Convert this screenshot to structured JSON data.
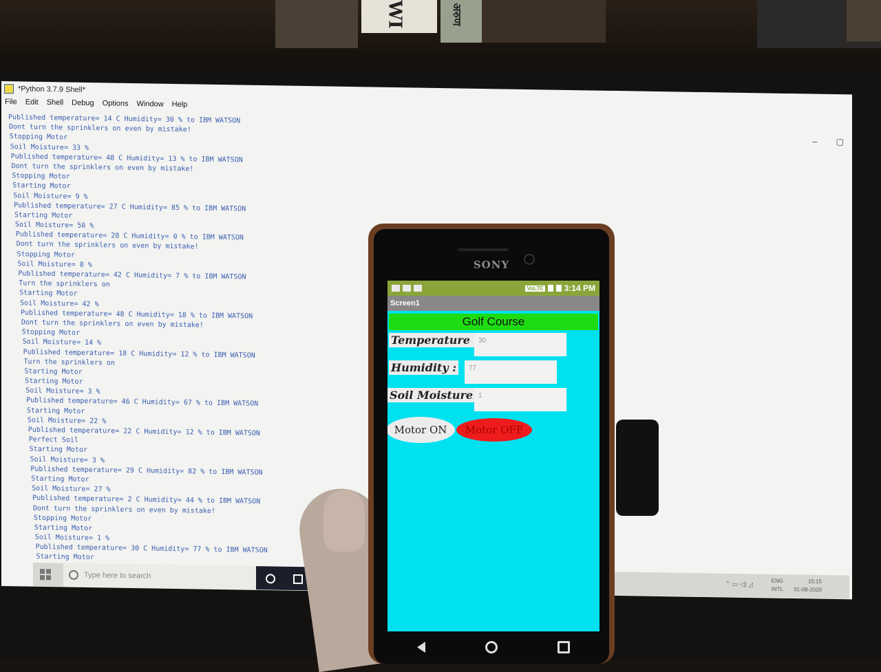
{
  "shelf": {
    "spine_text": "WI",
    "spine_text_2": "अरुण"
  },
  "window": {
    "title": "*Python 3.7.9 Shell*",
    "menu": [
      "File",
      "Edit",
      "Shell",
      "Debug",
      "Options",
      "Window",
      "Help"
    ],
    "controls": [
      "–",
      "▢"
    ]
  },
  "shell_lines": [
    "Published temperature= 14 C Humidity= 30 % to IBM WATSON",
    "Dont turn the sprinklers on even by mistake!",
    "Stopping Motor",
    "Soil Moisture= 33 %",
    "Published temperature= 48 C Humidity= 13 % to IBM WATSON",
    "Dont turn the sprinklers on even by mistake!",
    "Stopping Motor",
    "Starting Motor",
    "Soil Moisture= 9 %",
    "Published temperature= 27 C Humidity= 85 % to IBM WATSON",
    "Starting Motor",
    "Soil Moisture= 50 %",
    "Published temperature= 28 C Humidity= 0 % to IBM WATSON",
    "Dont turn the sprinklers on even by mistake!",
    "Stopping Motor",
    "Soil Moisture= 8 %",
    "Published temperature= 42 C Humidity= 7 % to IBM WATSON",
    "Turn the sprinklers on",
    "Starting Motor",
    "Soil Moisture= 42 %",
    "Published temperature= 48 C Humidity= 18 % to IBM WATSON",
    "Dont turn the sprinklers on even by mistake!",
    "Stopping Motor",
    "Soil Moisture= 14 %",
    "Published temperature= 18 C Humidity= 12 % to IBM WATSON",
    "Turn the sprinklers on",
    "Starting Motor",
    "Starting Motor",
    "Soil Moisture= 3 %",
    "Published temperature= 46 C Humidity= 67 % to IBM WATSON",
    "Starting Motor",
    "Soil Moisture= 22 %",
    "Published temperature= 22 C Humidity= 12 % to IBM WATSON",
    "Perfect Soil",
    "Starting Motor",
    "Soil Moisture= 3 %",
    "Published temperature= 29 C Humidity= 82 % to IBM WATSON",
    "Starting Motor",
    "Soil Moisture= 27 %",
    "Published temperature= 2 C Humidity= 44 % to IBM WATSON",
    "Dont turn the sprinklers on even by mistake!",
    "Stopping Motor",
    "Starting Motor",
    "Soil Moisture= 1 %",
    "Published temperature= 30 C Humidity= 77 % to IBM WATSON",
    "Starting Motor"
  ],
  "taskbar": {
    "search_placeholder": "Type here to search",
    "lang": "ENG",
    "lang2": "INTL",
    "time": "15:15",
    "date": "31-08-2020"
  },
  "phone": {
    "brand": "SONY",
    "status_time": "3:14 PM",
    "status_badge": "VoLTE",
    "screen_title": "Screen1",
    "app_title": "Golf Course",
    "temperature_label": "Temperature :",
    "temperature_value": "30",
    "humidity_label": "Humidity :",
    "humidity_value": "77",
    "soil_label": "Soil Moisture :",
    "soil_value": "1",
    "motor_on_label": "Motor ON",
    "motor_off_label": "Motor OFF"
  },
  "colors": {
    "app_bg": "#00e1f0",
    "title_bg": "#1ddc12",
    "motor_off_bg": "#ee1c1c",
    "shell_text": "#3b5fb0"
  }
}
